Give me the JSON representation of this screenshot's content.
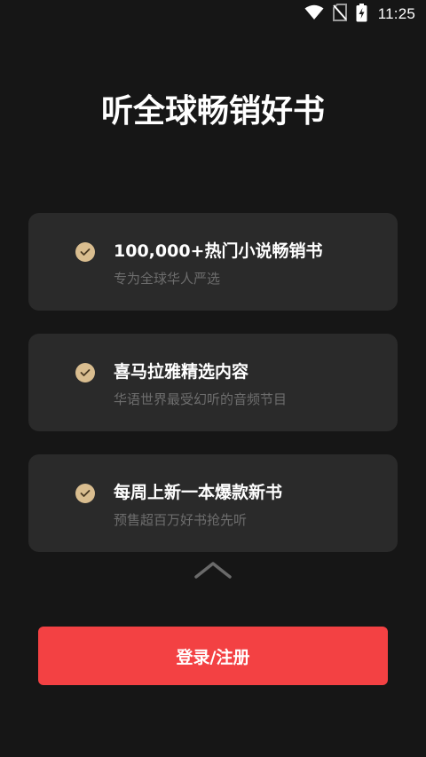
{
  "status_bar": {
    "time": "11:25",
    "icons": [
      "wifi-icon",
      "no-sim-icon",
      "battery-charging-icon"
    ]
  },
  "headline": "听全球畅销好书",
  "features": [
    {
      "title": "100,000+热门小说畅销书",
      "subtitle": "专为全球华人严选",
      "icon": "check-circle-icon"
    },
    {
      "title": "喜马拉雅精选内容",
      "subtitle": "华语世界最受幻听的音频节目",
      "icon": "check-circle-icon"
    },
    {
      "title": "每周上新一本爆款新书",
      "subtitle": "预售超百万好书抢先听",
      "icon": "check-circle-icon"
    }
  ],
  "expand_icon": "chevron-up-icon",
  "login_button": {
    "label": "登录/注册"
  },
  "colors": {
    "background": "#161616",
    "card": "#2a2a2a",
    "check": "#d9bd8f",
    "accent": "#f34143",
    "subtext": "#6d6d6d"
  }
}
